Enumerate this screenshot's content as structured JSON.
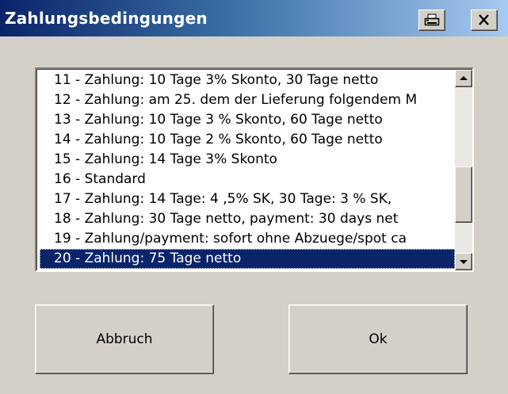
{
  "window": {
    "title": "Zahlungsbedingungen",
    "title_gradient_start": "#0a246a",
    "title_gradient_end": "#a6caf0",
    "face_color": "#d4d0c8"
  },
  "titlebar_buttons": {
    "print_icon": "printer-icon",
    "close_icon": "close-x-icon"
  },
  "list": {
    "items": [
      {
        "label": "11 - Zahlung: 10 Tage 3% Skonto, 30 Tage netto"
      },
      {
        "label": "12 - Zahlung: am 25. dem der Lieferung folgendem M"
      },
      {
        "label": "13 - Zahlung: 10 Tage 3 % Skonto, 60 Tage netto"
      },
      {
        "label": "14 - Zahlung: 10 Tage 2 % Skonto, 60 Tage netto"
      },
      {
        "label": "15 - Zahlung: 14 Tage 3% Skonto"
      },
      {
        "label": "16 - Standard"
      },
      {
        "label": "17 - Zahlung: 14 Tage: 4 ,5% SK, 30 Tage: 3 % SK,"
      },
      {
        "label": "18 - Zahlung: 30 Tage netto, payment: 30 days net"
      },
      {
        "label": "19 - Zahlung/payment: sofort ohne Abzuege/spot ca"
      },
      {
        "label": "20 - Zahlung: 75 Tage netto"
      }
    ],
    "selected_index": 9,
    "selection_color": "#0a246a"
  },
  "buttons": {
    "cancel_label": "Abbruch",
    "ok_label": "Ok"
  }
}
